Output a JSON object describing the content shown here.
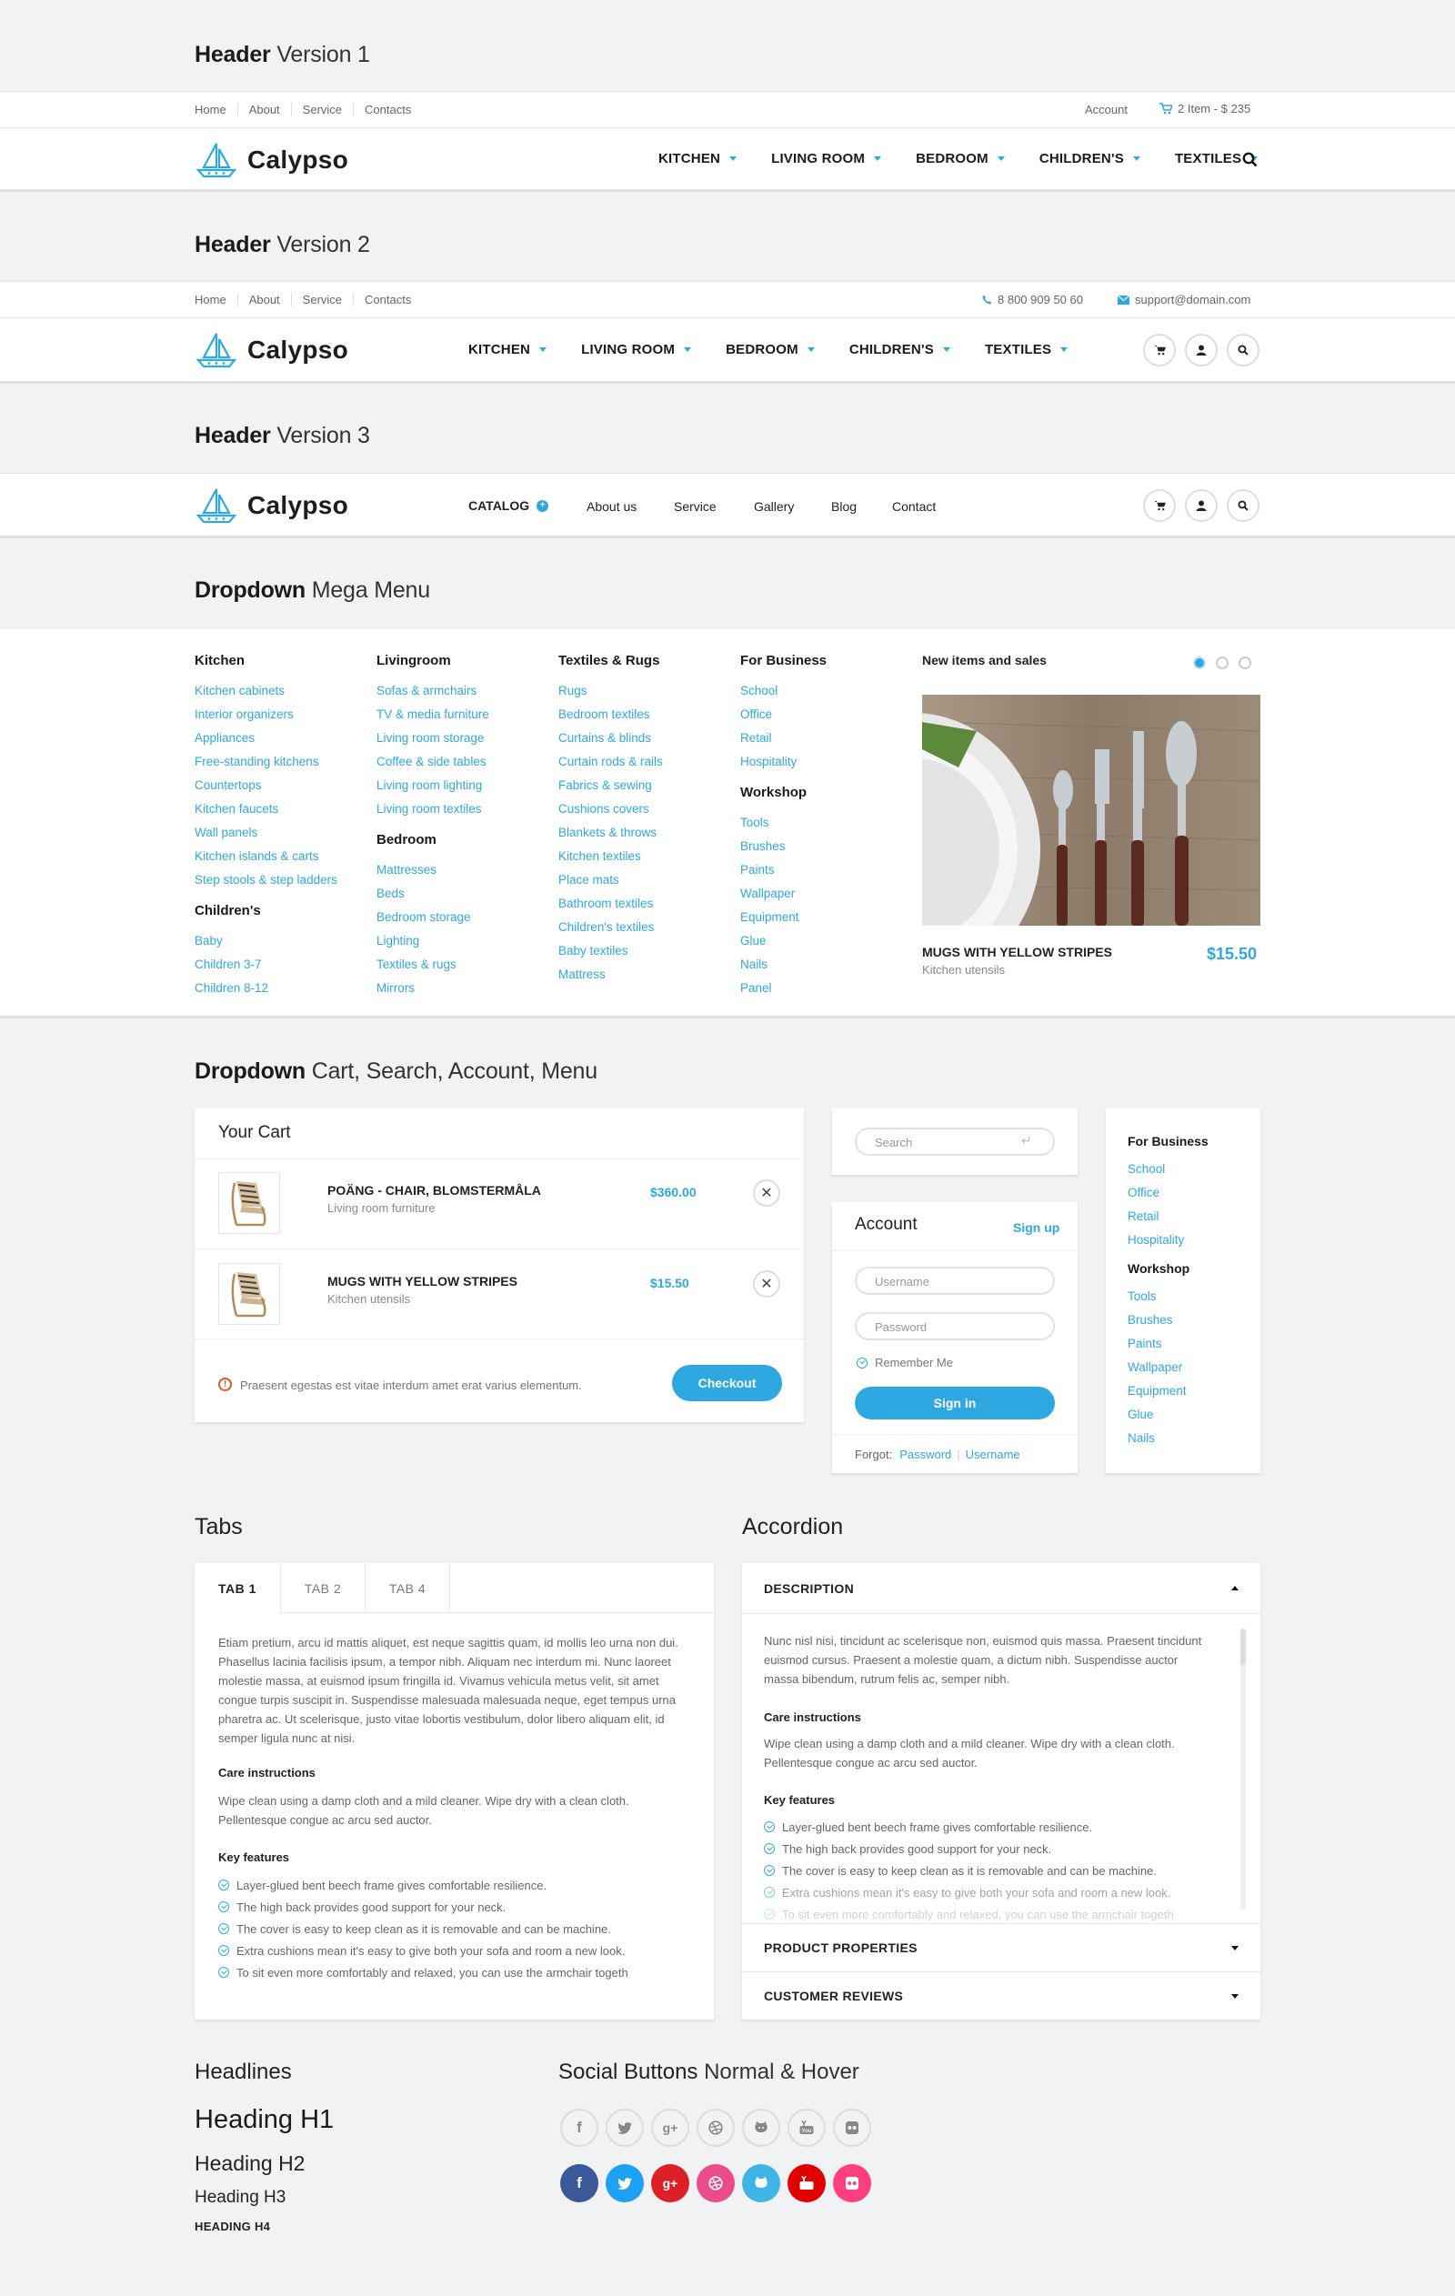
{
  "headers": {
    "h1": {
      "bold": "Header",
      "light": " Version 1"
    },
    "h2": {
      "bold": "Header",
      "light": " Version 2"
    },
    "h3": {
      "bold": "Header",
      "light": " Version 3"
    }
  },
  "toplinks": [
    "Home",
    "About",
    "Service",
    "Contacts"
  ],
  "v1": {
    "account": "Account",
    "cart": "2 Item - $ 235"
  },
  "v2": {
    "phone": "8 800 909 50 60",
    "email": "support@domain.com"
  },
  "logo": "Calypso",
  "nav": [
    "KITCHEN",
    "LIVING ROOM",
    "BEDROOM",
    "CHILDREN'S",
    "TEXTILES"
  ],
  "v3nav": {
    "catalog": "CATALOG",
    "items": [
      "About us",
      "Service",
      "Gallery",
      "Blog",
      "Contact"
    ]
  },
  "mega": {
    "title_bold": "Dropdown",
    "title_light": " Mega Menu",
    "kitchen": {
      "title": "Kitchen",
      "items": [
        "Kitchen cabinets",
        "Interior organizers",
        "Appliances",
        "Free-standing kitchens",
        "Countertops",
        "Kitchen faucets",
        "Wall panels",
        "Kitchen islands & carts",
        "Step stools & step ladders"
      ]
    },
    "childrens": {
      "title": "Children's",
      "items": [
        "Baby",
        "Children 3-7",
        "Children 8-12"
      ]
    },
    "livingroom": {
      "title": "Livingroom",
      "items": [
        "Sofas & armchairs",
        "TV & media furniture",
        "Living room storage",
        "Coffee & side tables",
        "Living room lighting",
        "Living room textiles"
      ]
    },
    "bedroom": {
      "title": "Bedroom",
      "items": [
        "Mattresses",
        "Beds",
        "Bedroom storage",
        "Lighting",
        "Textiles & rugs",
        "Mirrors"
      ]
    },
    "textiles": {
      "title": "Textiles & Rugs",
      "items": [
        "Rugs",
        "Bedroom textiles",
        "Curtains & blinds",
        "Curtain rods & rails",
        "Fabrics & sewing",
        "Cushions covers",
        "Blankets & throws",
        "Kitchen textiles",
        "Place mats",
        "Bathroom textiles",
        "Children's textiles",
        "Baby textiles",
        "Mattress"
      ]
    },
    "business": {
      "title": "For Business",
      "items": [
        "School",
        "Office",
        "Retail",
        "Hospitality"
      ]
    },
    "workshop": {
      "title": "Workshop",
      "items": [
        "Tools",
        "Brushes",
        "Paints",
        "Wallpaper",
        "Equipment",
        "Glue",
        "Nails",
        "Panel"
      ]
    },
    "promo": {
      "title": "New items and sales",
      "product": "MUGS WITH YELLOW STRIPES",
      "category": "Kitchen utensils",
      "price": "$15.50"
    }
  },
  "dropdown": {
    "title_bold": "Dropdown",
    "title_light": " Cart, Search, Account, Menu",
    "cart": {
      "title": "Your Cart",
      "items": [
        {
          "name": "POÄNG - CHAIR, BLOMSTERMÅLA",
          "category": "Living room furniture",
          "price": "$360.00"
        },
        {
          "name": "MUGS WITH YELLOW STRIPES",
          "category": "Kitchen utensils",
          "price": "$15.50"
        }
      ],
      "note": "Praesent egestas est vitae interdum amet erat varius elementum.",
      "checkout": "Checkout"
    },
    "search": {
      "placeholder": "Search"
    },
    "account": {
      "title": "Account",
      "signup": "Sign up",
      "username": "Username",
      "password": "Password",
      "remember": "Remember Me",
      "signin": "Sign in",
      "forgot": "Forgot:",
      "forgot_password": "Password",
      "forgot_username": "Username"
    },
    "menu": {
      "business": "For Business",
      "business_items": [
        "School",
        "Office",
        "Retail",
        "Hospitality"
      ],
      "workshop": "Workshop",
      "workshop_items": [
        "Tools",
        "Brushes",
        "Paints",
        "Wallpaper",
        "Equipment",
        "Glue",
        "Nails"
      ]
    }
  },
  "tabs": {
    "title": "Tabs",
    "labels": [
      "TAB 1",
      "TAB 2",
      "TAB 4"
    ],
    "text": "Etiam pretium, arcu id mattis aliquet, est neque sagittis quam, id mollis leo urna non dui. Phasellus lacinia facilisis ipsum, a tempor nibh. Aliquam nec interdum mi. Nunc laoreet molestie massa, at euismod ipsum fringilla id. Vivamus vehicula metus velit, sit amet congue turpis suscipit in. Suspendisse malesuada malesuada neque, eget tempus urna pharetra ac. Ut scelerisque, justo vitae lobortis vestibulum, dolor libero aliquam elit, id semper ligula nunc at nisi.",
    "care_title": "Care instructions",
    "care_text": "Wipe clean using a damp cloth and a mild cleaner. Wipe dry with a clean cloth. Pellentesque congue ac arcu sed auctor.",
    "features_title": "Key features",
    "features": [
      "Layer-glued bent beech frame gives comfortable resilience.",
      "The high back provides good support for your neck.",
      "The cover is easy to keep clean as it is removable and can be machine.",
      "Extra cushions mean it's easy to give both your sofa and room a new look.",
      "To sit even more comfortably and relaxed, you can use the armchair togeth"
    ]
  },
  "accordion": {
    "title": "Accordion",
    "description": "DESCRIPTION",
    "text": "Nunc nisl nisi, tincidunt ac scelerisque non, euismod quis massa. Praesent tincidunt euismod cursus. Praesent a molestie quam, a dictum nibh. Suspendisse auctor massa bibendum, rutrum felis ac, semper nibh.",
    "care_title": "Care instructions",
    "care_text": "Wipe clean using a damp cloth and a mild cleaner. Wipe dry with a clean cloth. Pellentesque congue ac arcu sed auctor.",
    "features_title": "Key features",
    "features": [
      "Layer-glued bent beech frame gives comfortable resilience.",
      "The high back provides good support for your neck.",
      "The cover is easy to keep clean as it is removable and can be machine.",
      "Extra cushions mean it's easy to give both your sofa and room a new look.",
      "To sit even more comfortably and relaxed, you can use the armchair togeth"
    ],
    "properties": "PRODUCT PROPERTIES",
    "reviews": "CUSTOMER REVIEWS"
  },
  "headlines": {
    "title": "Headlines",
    "h1": "Heading H1",
    "h2": "Heading H2",
    "h3": "Heading H3",
    "h4": "HEADING H4"
  },
  "social": {
    "title_bold": "Social Buttons",
    "title_light": " Normal & Hover",
    "icons": [
      "facebook-icon",
      "twitter-icon",
      "google-plus-icon",
      "dribbble-icon",
      "github-icon",
      "youtube-icon",
      "flickr-icon"
    ],
    "colors": [
      "#3b5998",
      "#1da1f2",
      "#dd1f26",
      "#ea4c89",
      "#3eb5e6",
      "#e00000",
      "#ff3f7f"
    ]
  },
  "colors": {
    "accent": "#2fa8e1"
  }
}
